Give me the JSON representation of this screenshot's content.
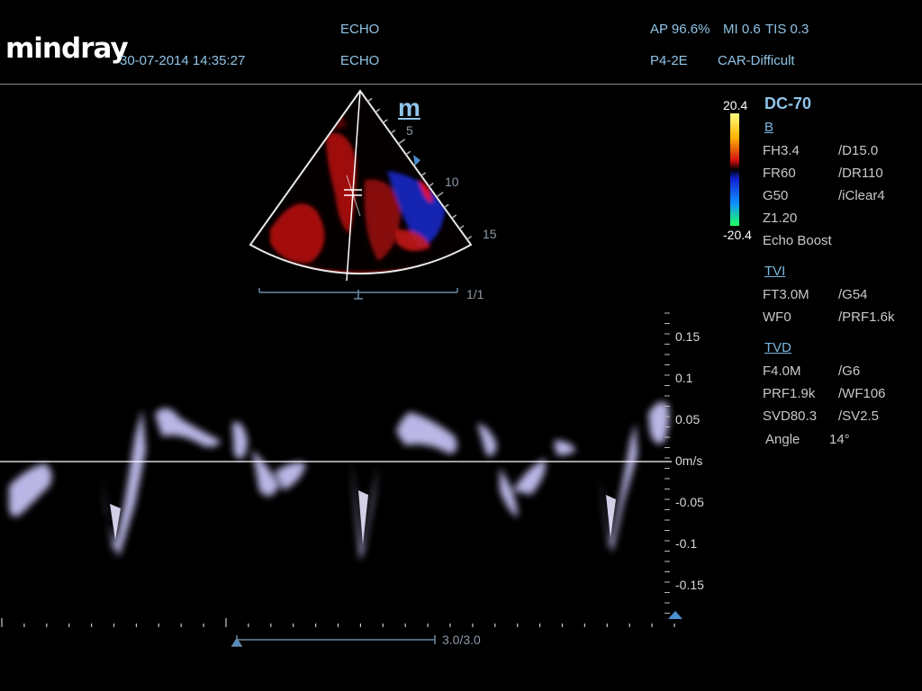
{
  "header": {
    "brand": "mindray",
    "datetime": "30-07-2014 14:35:27",
    "patient_name": "ECHO",
    "patient_id": "ECHO",
    "power": "AP 96.6%",
    "mi": "MI 0.6",
    "tis": "TIS 0.3",
    "probe": "P4-2E",
    "exam_mode": "CAR-Difficult"
  },
  "color_bar": {
    "max": "20.4",
    "min": "-20.4"
  },
  "image": {
    "mode_marker": "m",
    "depth_ticks": [
      "5",
      "10",
      "15"
    ],
    "frame_counter": "1/1"
  },
  "side_panel": {
    "model": "DC-70",
    "b_mode": {
      "title": "B",
      "rows": [
        [
          "FH3.4",
          "/D15.0"
        ],
        [
          "FR60",
          "/DR110"
        ],
        [
          "G50",
          "/iClear4"
        ],
        [
          "Z1.20",
          ""
        ]
      ],
      "extra": "Echo Boost"
    },
    "tvi": {
      "title": "TVI",
      "rows": [
        [
          "FT3.0M",
          "/G54"
        ],
        [
          "WF0",
          "/PRF1.6k"
        ]
      ]
    },
    "tvd": {
      "title": "TVD",
      "rows": [
        [
          "F4.0M",
          "/G6"
        ],
        [
          "PRF1.9k",
          "/WF106"
        ],
        [
          "SVD80.3",
          "/SV2.5"
        ]
      ],
      "angle_label": "Angle",
      "angle_value": "14°"
    }
  },
  "doppler": {
    "velocity_labels": [
      "0.15",
      "0.1",
      "0.05",
      "0m/s",
      "-0.05",
      "-0.1",
      "-0.15"
    ],
    "sweep_speed": "3.0/3.0"
  },
  "colors": {
    "text_blue": "#8fc3e6",
    "spectrum": "#d8d4ff",
    "doppler_red": "#e01a12",
    "doppler_blue": "#1a33d8"
  }
}
